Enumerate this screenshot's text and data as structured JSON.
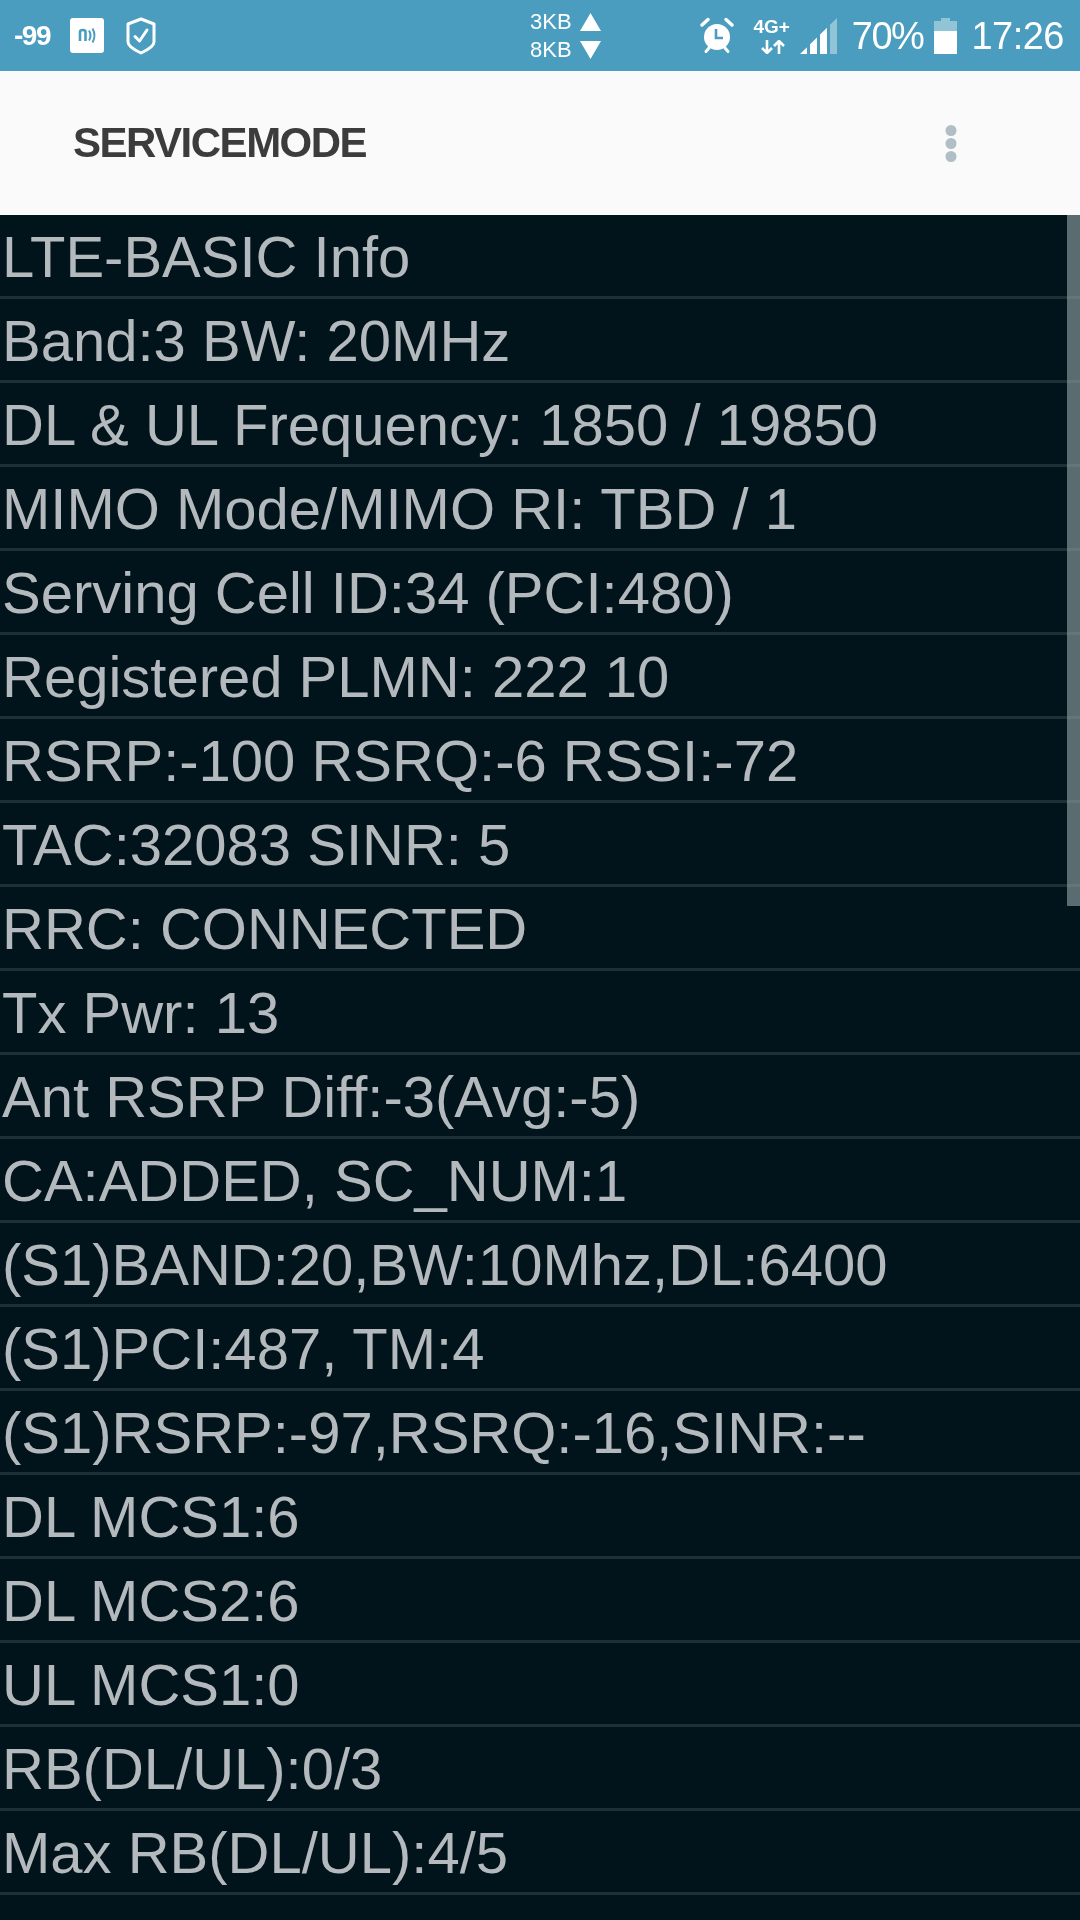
{
  "status_bar": {
    "signal_reading": "-99",
    "upload": "3KB",
    "download": "8KB",
    "network": "4G+",
    "battery": "70%",
    "time": "17:26"
  },
  "app_bar": {
    "title": "SERVICEMODE"
  },
  "info_lines": [
    "LTE-BASIC Info",
    "Band:3 BW: 20MHz",
    "DL & UL Frequency: 1850 / 19850",
    "MIMO Mode/MIMO RI: TBD / 1",
    "Serving Cell ID:34 (PCI:480)",
    "Registered PLMN: 222 10",
    "RSRP:-100 RSRQ:-6 RSSI:-72",
    "TAC:32083 SINR: 5",
    "RRC: CONNECTED",
    "Tx Pwr: 13",
    "Ant RSRP Diff:-3(Avg:-5)",
    "CA:ADDED, SC_NUM:1",
    "(S1)BAND:20,BW:10Mhz,DL:6400",
    "(S1)PCI:487, TM:4",
    "(S1)RSRP:-97,RSRQ:-16,SINR:--",
    "DL MCS1:6",
    "DL MCS2:6",
    "UL MCS1:0",
    "RB(DL/UL):0/3",
    "Max RB(DL/UL):4/5"
  ]
}
